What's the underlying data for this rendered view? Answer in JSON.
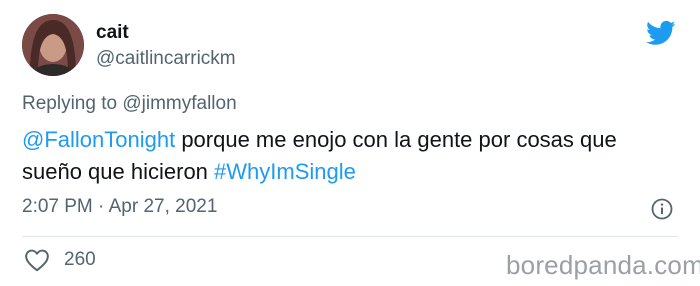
{
  "author": {
    "name": "cait",
    "handle": "@caitlincarrickm"
  },
  "replying": {
    "prefix": "Replying to ",
    "target": "@jimmyfallon"
  },
  "tweet": {
    "mention": "@FallonTonight",
    "text": " porque me enojo con la gente por cosas que sueño que hicieron ",
    "hashtag": "#WhyImSingle"
  },
  "meta": {
    "time": "2:07 PM",
    "separator": " · ",
    "date": "Apr 27, 2021"
  },
  "stats": {
    "likes": "260"
  },
  "watermark": "boredpanda.com",
  "colors": {
    "accent": "#1d9bf0",
    "secondary_text": "#536471",
    "primary_text": "#0f1419"
  },
  "icons": [
    "twitter-bird-icon",
    "info-icon",
    "heart-icon"
  ]
}
